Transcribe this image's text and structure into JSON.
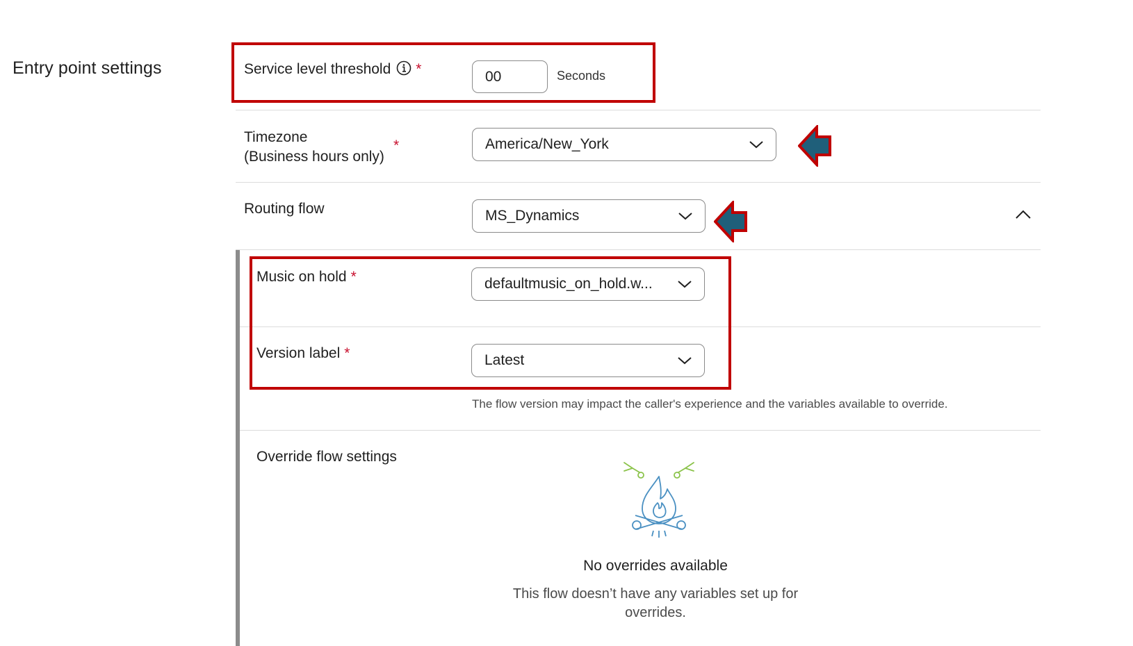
{
  "section": {
    "title": "Entry point settings"
  },
  "service_level": {
    "label": "Service level threshold",
    "required": "*",
    "value": "00",
    "unit": "Seconds",
    "info_icon": "info-icon"
  },
  "timezone": {
    "label_line1": "Timezone",
    "label_line2": "(Business hours only)",
    "required": "*",
    "value": "America/New_York"
  },
  "routing_flow": {
    "label": "Routing flow",
    "value": "MS_Dynamics",
    "collapse_icon": "chevron-up-icon"
  },
  "music_on_hold": {
    "label": "Music on hold",
    "required": "*",
    "value": "defaultmusic_on_hold.w..."
  },
  "version_label": {
    "label": "Version label",
    "required": "*",
    "value": "Latest",
    "help": "The flow version may impact the caller's experience and the variables available to override."
  },
  "override": {
    "label": "Override flow settings",
    "empty_icon": "campfire-illustration",
    "empty_title": "No overrides available",
    "empty_desc_line1": "This flow doesn’t have any variables set up for",
    "empty_desc_line2": "overrides."
  },
  "colors": {
    "highlight": "#c00000",
    "arrow_fill": "#1f5f7a",
    "required": "#c8102e",
    "campfire_green": "#8bc34a",
    "campfire_blue": "#4a90c2"
  }
}
